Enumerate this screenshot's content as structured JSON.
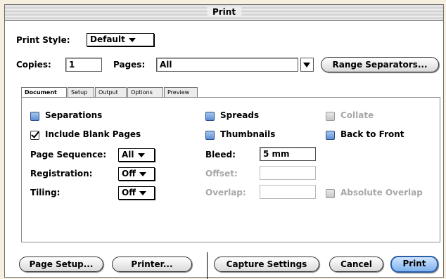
{
  "window": {
    "title": "Print"
  },
  "header": {
    "print_style_label": "Print Style:",
    "print_style_value": "Default",
    "copies_label": "Copies:",
    "copies_value": "1",
    "pages_label": "Pages:",
    "pages_value": "All",
    "range_separators_label": "Range Separators..."
  },
  "tabs": [
    "Document",
    "Setup",
    "Output",
    "Options",
    "Preview"
  ],
  "active_tab": "Document",
  "document": {
    "separations": {
      "label": "Separations",
      "checked": false
    },
    "include_blank_pages": {
      "label": "Include Blank Pages",
      "checked": true
    },
    "spreads": {
      "label": "Spreads",
      "checked": false
    },
    "thumbnails": {
      "label": "Thumbnails",
      "checked": false
    },
    "collate": {
      "label": "Collate",
      "checked": false,
      "enabled": false
    },
    "back_to_front": {
      "label": "Back to Front",
      "checked": false
    },
    "page_sequence_label": "Page Sequence:",
    "page_sequence_value": "All",
    "registration_label": "Registration:",
    "registration_value": "Off",
    "tiling_label": "Tiling:",
    "tiling_value": "Off",
    "bleed_label": "Bleed:",
    "bleed_value": "5 mm",
    "offset_label": "Offset:",
    "offset_value": "",
    "overlap_label": "Overlap:",
    "overlap_value": "",
    "absolute_overlap": {
      "label": "Absolute Overlap",
      "checked": false,
      "enabled": false
    }
  },
  "buttons": {
    "page_setup": "Page Setup...",
    "printer": "Printer...",
    "capture_settings": "Capture Settings",
    "cancel": "Cancel",
    "print": "Print"
  },
  "colors": {
    "background": "#f6eedf",
    "checkbox_blue": "#5d8fd6",
    "default_button": "#7fb1ee"
  }
}
